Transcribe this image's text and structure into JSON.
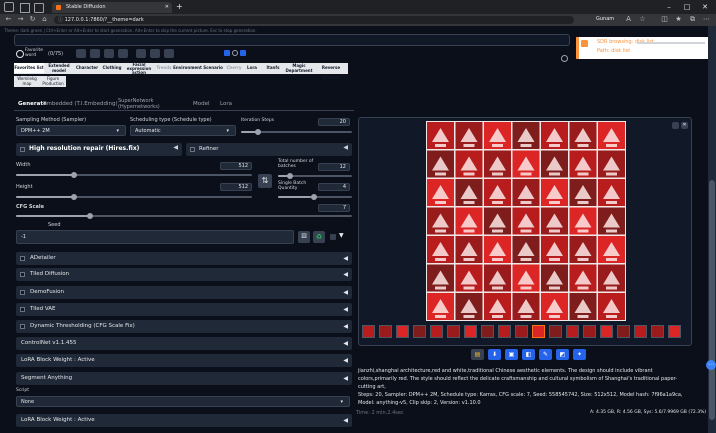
{
  "browser": {
    "tab_title": "Stable Diffusion",
    "url": "127.0.0.1:7860/?__theme=dark",
    "profile": "Gunam",
    "nav_icons": [
      "back-icon",
      "forward-icon",
      "reload-icon",
      "home-icon"
    ]
  },
  "header": {
    "hint": "Theme: dark green | Ctrl+Enter or Alt+Enter to start generation. Alt+Enter to skip the current picture. Esc to stop generation.",
    "tag_label": "Favorite word",
    "tag_count": "(0/75)"
  },
  "categories": [
    "Favorites list",
    "Extended model",
    "Character",
    "Clothing",
    "Facial expression action",
    "Trends",
    "Environment Scenario",
    "Cherry",
    "Lora",
    "Itanfs",
    "Magic Department",
    "Reverse prompt"
  ],
  "categories2": [
    "Wemilekg map",
    "Figure Production"
  ],
  "notice": {
    "line1": "SDR browsing: disk list",
    "line2": "Path: disk list"
  },
  "tabs": [
    "Generate",
    "Embedded (T.I.Embedding)",
    "SuperNetwork (Hypernetworks)",
    "Model",
    "Lora"
  ],
  "params": {
    "sampling_method_label": "Sampling Method (Sampler)",
    "sampling_method_value": "DPM++ 2M",
    "schedule_label": "Scheduling type (Schedule type)",
    "schedule_value": "Automatic",
    "iteration_label": "Iteration Steps",
    "iteration_value": "20",
    "hires_label": "High resolution repair (Hires.fix)",
    "refiner_label": "Refiner",
    "width_label": "Width",
    "width_value": "512",
    "height_label": "Height",
    "height_value": "512",
    "batches_label": "Total number of batches",
    "batches_value": "12",
    "batch_qty_label": "Single Batch Quantity",
    "batch_qty_value": "4",
    "cfg_label": "CFG Scale",
    "cfg_value": "7",
    "seed_label": "Seed",
    "seed_value": "-1"
  },
  "accordions": [
    "ADetailer",
    "Tiled Diffusion",
    "DemoFusion",
    "Tiled VAE",
    "Dynamic Thresholding (CFG Scale Fix)",
    "ControlNet v1.1.455",
    "LoRA Block Weight : Active",
    "Segment Anything"
  ],
  "script": {
    "label": "Script",
    "value": "None",
    "last_accordion": "LoRA Block Weight : Active"
  },
  "output": {
    "info": "jianzhi,shanghai architecture,red and white,traditional Chinese aesthetic elements. The design should include vibrant colors,primarily red. The style should reflect the delicate craftsmanship and cultural symbolism of Shanghai's traditional paper-cutting art,",
    "info2": "Steps: 20, Sampler: DPM++ 2M, Schedule type: Karras, CFG scale: 7, Seed: 558545742, Size: 512x512, Model hash: 7f96a1a9ca, Model: anything-v5, Clip skip: 2, Version: v1.10.0",
    "time": "Time: 2 min.2.4sec",
    "vram": "A: 4.35 GB, R: 4.56 GB, Sys: 5.6/7.9969 GB (72.3%)",
    "tool_icons": [
      "folder-icon",
      "save-icon",
      "zip-icon",
      "img2img-icon",
      "inpaint-icon",
      "extras-icon",
      "star-icon"
    ]
  },
  "colors": {
    "accent": "#2563eb",
    "panel": "#111827",
    "bg": "#0b0f19",
    "art_red": "#b91c1c"
  }
}
